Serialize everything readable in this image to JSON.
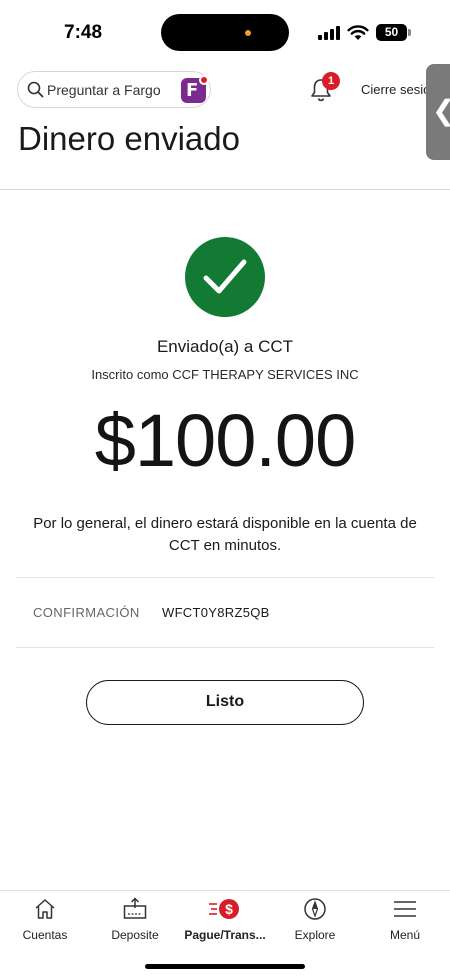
{
  "status_bar": {
    "time": "7:48",
    "battery": "50"
  },
  "header": {
    "search_placeholder": "Preguntar a Fargo",
    "notification_count": "1",
    "logout_label": "Cierre sesión",
    "side_tab_glyph": "❮"
  },
  "page": {
    "title": "Dinero enviado"
  },
  "confirmation": {
    "sent_to": "Enviado(a) a CCT",
    "enrolled_as": "Inscrito como CCF THERAPY SERVICES INC",
    "amount": "$100.00",
    "availability": "Por lo general, el dinero estará disponible en la cuenta de CCT en minutos.",
    "conf_label": "CONFIRMACIÓN",
    "conf_number": "WFCT0Y8RZ5QB",
    "done_label": "Listo"
  },
  "tabbar": {
    "items": [
      {
        "label": "Cuentas",
        "icon": "home-icon"
      },
      {
        "label": "Deposite",
        "icon": "deposit-icon"
      },
      {
        "label": "Pague/Trans...",
        "icon": "pay-transfer-icon",
        "active": true
      },
      {
        "label": "Explore",
        "icon": "compass-icon"
      },
      {
        "label": "Menú",
        "icon": "hamburger-icon"
      }
    ]
  },
  "colors": {
    "success_green": "#137a33",
    "brand_red": "#d71e28",
    "fargo_purple": "#7b2a8f"
  }
}
